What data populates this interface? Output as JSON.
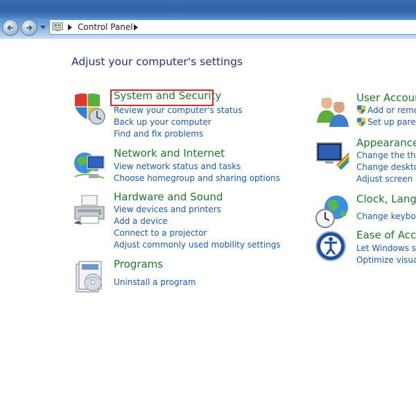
{
  "nav": {
    "breadcrumb": "Control Panel"
  },
  "page": {
    "title": "Adjust your computer's settings"
  },
  "left_categories": [
    {
      "title": "System and Security",
      "links": [
        "Review your computer's status",
        "Back up your computer",
        "Find and fix problems"
      ],
      "icon": "shield-icon"
    },
    {
      "title": "Network and Internet",
      "links": [
        "View network status and tasks",
        "Choose homegroup and sharing options"
      ],
      "icon": "network-globe-icon"
    },
    {
      "title": "Hardware and Sound",
      "links": [
        "View devices and printers",
        "Add a device",
        "Connect to a projector",
        "Adjust commonly used mobility settings"
      ],
      "icon": "printer-icon"
    },
    {
      "title": "Programs",
      "links": [
        "Uninstall a program"
      ],
      "icon": "programs-disc-icon"
    }
  ],
  "right_categories": [
    {
      "title": "User Accoun",
      "links": [
        "Add or remov",
        "Set up parent"
      ],
      "icon": "users-icon"
    },
    {
      "title": "Appearance",
      "links": [
        "Change the ther",
        "Change desktop",
        "Adjust screen re"
      ],
      "icon": "appearance-monitor-icon"
    },
    {
      "title": "Clock, Langu",
      "links": [
        "Change keyboar"
      ],
      "icon": "clock-globe-icon"
    },
    {
      "title": "Ease of Acce",
      "links": [
        "Let Windows sug",
        "Optimize visual d"
      ],
      "icon": "ease-of-access-icon"
    }
  ],
  "colors": {
    "category_heading": "#1e7a2b",
    "link": "#1a5bbf",
    "page_title": "#1e3287",
    "highlight_box": "#d42a2a"
  }
}
